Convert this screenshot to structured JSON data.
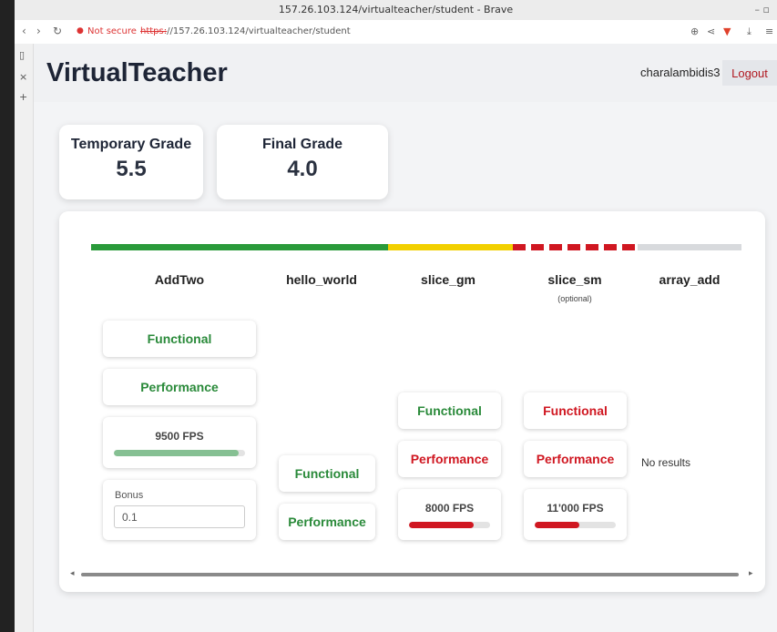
{
  "browser": {
    "window_title": "157.26.103.124/virtualteacher/student - Brave",
    "not_secure_label": "Not secure",
    "url_scheme": "https:",
    "url_rest": "//157.26.103.124/virtualteacher/student"
  },
  "header": {
    "logo": "VirtualTeacher",
    "username": "charalambidis3",
    "logout_label": "Logout"
  },
  "grades": {
    "temporary": {
      "label": "Temporary Grade",
      "value": "5.5"
    },
    "final": {
      "label": "Final Grade",
      "value": "4.0"
    }
  },
  "progress_segments": [
    {
      "name": "AddTwo",
      "status": "complete",
      "color": "#2a9a3a"
    },
    {
      "name": "hello_world",
      "status": "complete",
      "color": "#2a9a3a"
    },
    {
      "name": "slice_gm",
      "status": "partial",
      "color": "#f2d000"
    },
    {
      "name": "slice_sm",
      "status": "optional-failed",
      "color": "#d01721",
      "style": "dashed"
    },
    {
      "name": "array_add",
      "status": "none",
      "color": "#d8dadd"
    }
  ],
  "exercises": [
    {
      "name": "AddTwo",
      "functional": {
        "label": "Functional",
        "status": "pass"
      },
      "performance": {
        "label": "Performance",
        "status": "pass"
      },
      "fps": {
        "label": "9500 FPS",
        "fraction": 0.95,
        "color": "#86c093"
      },
      "bonus": {
        "label": "Bonus",
        "value": "0.1"
      }
    },
    {
      "name": "hello_world",
      "functional": {
        "label": "Functional",
        "status": "pass"
      },
      "performance": {
        "label": "Performance",
        "status": "pass"
      }
    },
    {
      "name": "slice_gm",
      "functional": {
        "label": "Functional",
        "status": "pass"
      },
      "performance": {
        "label": "Performance",
        "status": "fail"
      },
      "fps": {
        "label": "8000 FPS",
        "fraction": 0.8,
        "color": "#d01721"
      }
    },
    {
      "name": "slice_sm",
      "subtitle": "(optional)",
      "functional": {
        "label": "Functional",
        "status": "fail"
      },
      "performance": {
        "label": "Performance",
        "status": "fail"
      },
      "fps": {
        "label": "11'000 FPS",
        "fraction": 0.55,
        "color": "#d01721"
      }
    },
    {
      "name": "array_add",
      "no_results": "No results"
    }
  ],
  "icons": {
    "back": "chevron-left-icon",
    "forward": "chevron-right-icon",
    "reload": "reload-icon",
    "zoom": "zoom-icon",
    "share": "share-icon",
    "brave": "brave-shield-icon",
    "download": "download-icon",
    "menu": "menu-icon",
    "sidebar": "sidebar-icon",
    "close_tab": "close-icon",
    "new_tab": "plus-icon"
  }
}
